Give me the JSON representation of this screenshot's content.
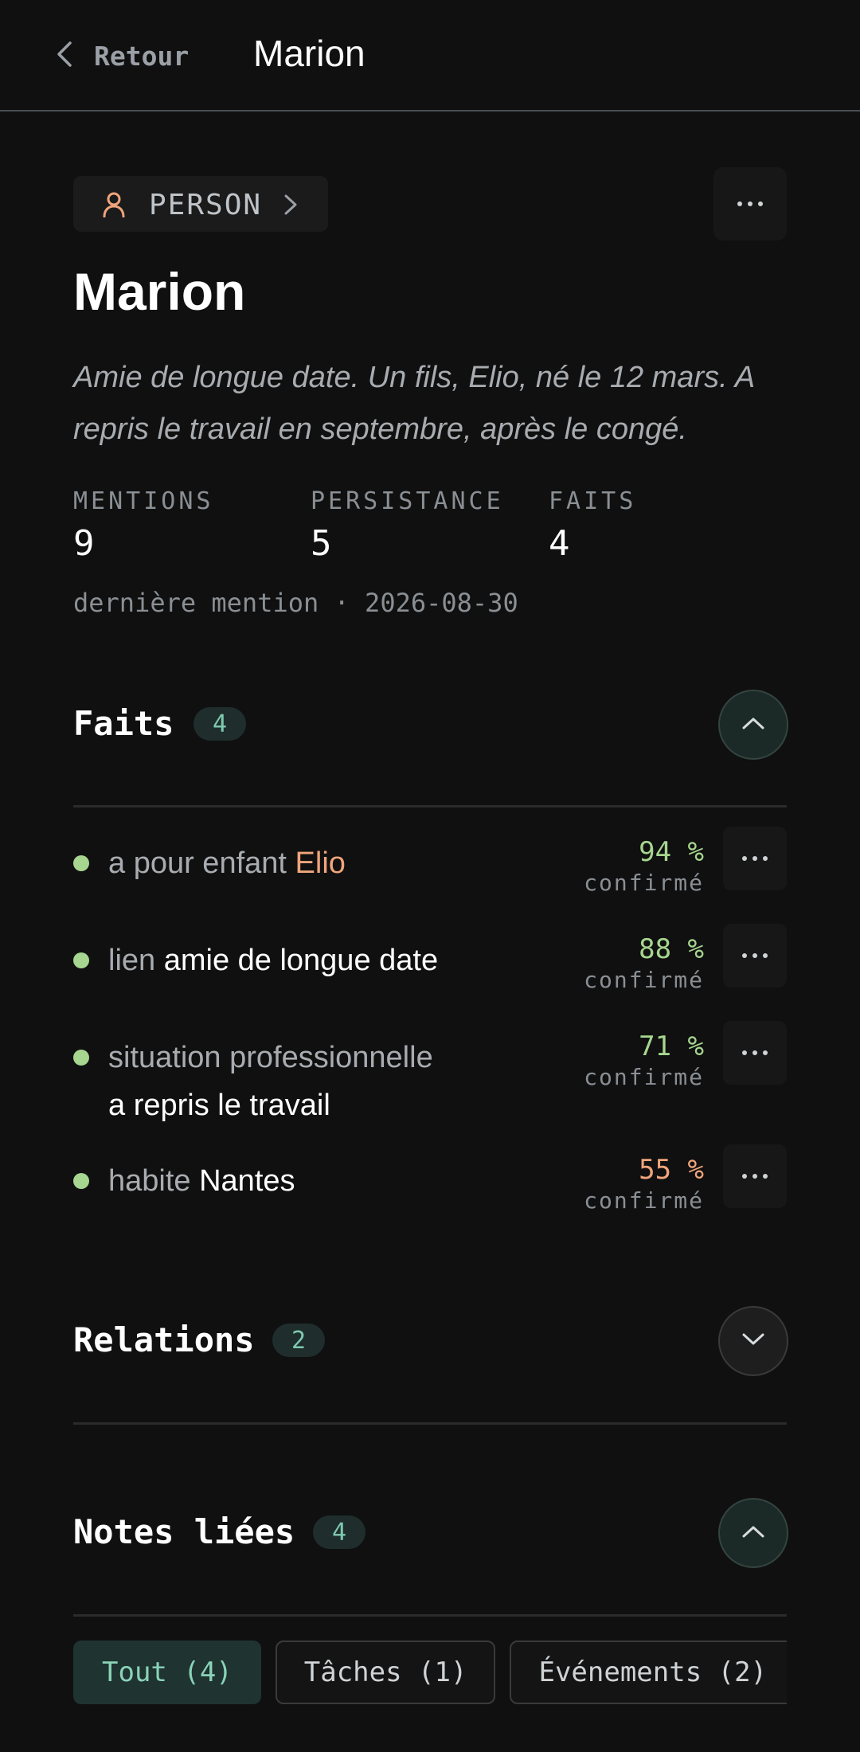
{
  "header": {
    "back_label": "Retour",
    "title": "Marion"
  },
  "entity": {
    "type_label": "PERSON",
    "name": "Marion",
    "description": "Amie de longue date. Un fils, Elio, né le 12 mars. A repris le travail en septembre, après le congé.",
    "stats": [
      {
        "label": "MENTIONS",
        "value": "9"
      },
      {
        "label": "PERSISTANCE",
        "value": "5"
      },
      {
        "label": "FAITS",
        "value": "4"
      }
    ],
    "last_mention": "dernière mention · 2026-08-30"
  },
  "facts": {
    "title": "Faits",
    "count": "4",
    "expanded": true,
    "items": [
      {
        "predicate": "a pour enfant",
        "object": "Elio",
        "percent": "94 %",
        "status": "confirmé",
        "color": "#a6d68f"
      },
      {
        "predicate": "lien",
        "object": "amie de longue date",
        "percent": "88 %",
        "status": "confirmé",
        "color": "#a6d68f"
      },
      {
        "predicate": "situation professionnelle",
        "object": "a repris le travail",
        "percent": "71 %",
        "status": "confirmé",
        "color": "#a6d68f"
      },
      {
        "predicate": "habite",
        "object": "Nantes",
        "percent": "55 %",
        "status": "confirmé",
        "color": "#f0a57c"
      }
    ]
  },
  "relations": {
    "title": "Relations",
    "count": "2",
    "expanded": false
  },
  "notes": {
    "title": "Notes liées",
    "count": "4",
    "expanded": true,
    "filters": [
      "Tout (4)",
      "Tâches (1)",
      "Événements (2)"
    ],
    "active_filter": "Tout (4)"
  },
  "colors": {
    "background": "#101010",
    "accent_teal": "#8ad3b8",
    "high_confidence": "#a6d68f",
    "low_confidence": "#f0a57c",
    "link": "#f0a57c"
  }
}
